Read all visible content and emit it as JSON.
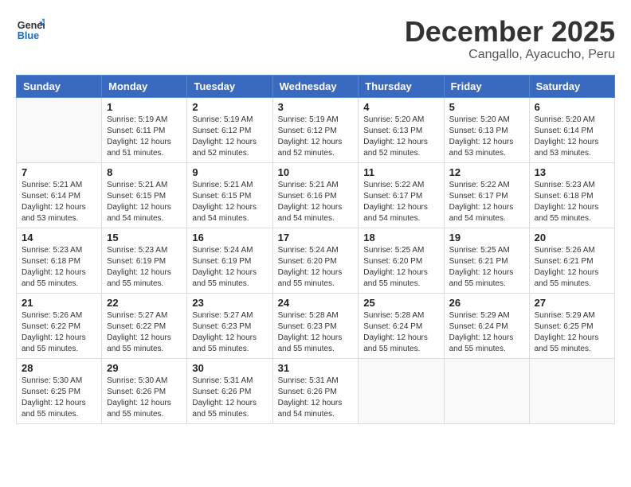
{
  "logo": {
    "line1": "General",
    "line2": "Blue"
  },
  "title": "December 2025",
  "subtitle": "Cangallo, Ayacucho, Peru",
  "header_days": [
    "Sunday",
    "Monday",
    "Tuesday",
    "Wednesday",
    "Thursday",
    "Friday",
    "Saturday"
  ],
  "weeks": [
    [
      {
        "day": "",
        "info": ""
      },
      {
        "day": "1",
        "info": "Sunrise: 5:19 AM\nSunset: 6:11 PM\nDaylight: 12 hours\nand 51 minutes."
      },
      {
        "day": "2",
        "info": "Sunrise: 5:19 AM\nSunset: 6:12 PM\nDaylight: 12 hours\nand 52 minutes."
      },
      {
        "day": "3",
        "info": "Sunrise: 5:19 AM\nSunset: 6:12 PM\nDaylight: 12 hours\nand 52 minutes."
      },
      {
        "day": "4",
        "info": "Sunrise: 5:20 AM\nSunset: 6:13 PM\nDaylight: 12 hours\nand 52 minutes."
      },
      {
        "day": "5",
        "info": "Sunrise: 5:20 AM\nSunset: 6:13 PM\nDaylight: 12 hours\nand 53 minutes."
      },
      {
        "day": "6",
        "info": "Sunrise: 5:20 AM\nSunset: 6:14 PM\nDaylight: 12 hours\nand 53 minutes."
      }
    ],
    [
      {
        "day": "7",
        "info": "Sunrise: 5:21 AM\nSunset: 6:14 PM\nDaylight: 12 hours\nand 53 minutes."
      },
      {
        "day": "8",
        "info": "Sunrise: 5:21 AM\nSunset: 6:15 PM\nDaylight: 12 hours\nand 54 minutes."
      },
      {
        "day": "9",
        "info": "Sunrise: 5:21 AM\nSunset: 6:15 PM\nDaylight: 12 hours\nand 54 minutes."
      },
      {
        "day": "10",
        "info": "Sunrise: 5:21 AM\nSunset: 6:16 PM\nDaylight: 12 hours\nand 54 minutes."
      },
      {
        "day": "11",
        "info": "Sunrise: 5:22 AM\nSunset: 6:17 PM\nDaylight: 12 hours\nand 54 minutes."
      },
      {
        "day": "12",
        "info": "Sunrise: 5:22 AM\nSunset: 6:17 PM\nDaylight: 12 hours\nand 54 minutes."
      },
      {
        "day": "13",
        "info": "Sunrise: 5:23 AM\nSunset: 6:18 PM\nDaylight: 12 hours\nand 55 minutes."
      }
    ],
    [
      {
        "day": "14",
        "info": "Sunrise: 5:23 AM\nSunset: 6:18 PM\nDaylight: 12 hours\nand 55 minutes."
      },
      {
        "day": "15",
        "info": "Sunrise: 5:23 AM\nSunset: 6:19 PM\nDaylight: 12 hours\nand 55 minutes."
      },
      {
        "day": "16",
        "info": "Sunrise: 5:24 AM\nSunset: 6:19 PM\nDaylight: 12 hours\nand 55 minutes."
      },
      {
        "day": "17",
        "info": "Sunrise: 5:24 AM\nSunset: 6:20 PM\nDaylight: 12 hours\nand 55 minutes."
      },
      {
        "day": "18",
        "info": "Sunrise: 5:25 AM\nSunset: 6:20 PM\nDaylight: 12 hours\nand 55 minutes."
      },
      {
        "day": "19",
        "info": "Sunrise: 5:25 AM\nSunset: 6:21 PM\nDaylight: 12 hours\nand 55 minutes."
      },
      {
        "day": "20",
        "info": "Sunrise: 5:26 AM\nSunset: 6:21 PM\nDaylight: 12 hours\nand 55 minutes."
      }
    ],
    [
      {
        "day": "21",
        "info": "Sunrise: 5:26 AM\nSunset: 6:22 PM\nDaylight: 12 hours\nand 55 minutes."
      },
      {
        "day": "22",
        "info": "Sunrise: 5:27 AM\nSunset: 6:22 PM\nDaylight: 12 hours\nand 55 minutes."
      },
      {
        "day": "23",
        "info": "Sunrise: 5:27 AM\nSunset: 6:23 PM\nDaylight: 12 hours\nand 55 minutes."
      },
      {
        "day": "24",
        "info": "Sunrise: 5:28 AM\nSunset: 6:23 PM\nDaylight: 12 hours\nand 55 minutes."
      },
      {
        "day": "25",
        "info": "Sunrise: 5:28 AM\nSunset: 6:24 PM\nDaylight: 12 hours\nand 55 minutes."
      },
      {
        "day": "26",
        "info": "Sunrise: 5:29 AM\nSunset: 6:24 PM\nDaylight: 12 hours\nand 55 minutes."
      },
      {
        "day": "27",
        "info": "Sunrise: 5:29 AM\nSunset: 6:25 PM\nDaylight: 12 hours\nand 55 minutes."
      }
    ],
    [
      {
        "day": "28",
        "info": "Sunrise: 5:30 AM\nSunset: 6:25 PM\nDaylight: 12 hours\nand 55 minutes."
      },
      {
        "day": "29",
        "info": "Sunrise: 5:30 AM\nSunset: 6:26 PM\nDaylight: 12 hours\nand 55 minutes."
      },
      {
        "day": "30",
        "info": "Sunrise: 5:31 AM\nSunset: 6:26 PM\nDaylight: 12 hours\nand 55 minutes."
      },
      {
        "day": "31",
        "info": "Sunrise: 5:31 AM\nSunset: 6:26 PM\nDaylight: 12 hours\nand 54 minutes."
      },
      {
        "day": "",
        "info": ""
      },
      {
        "day": "",
        "info": ""
      },
      {
        "day": "",
        "info": ""
      }
    ]
  ]
}
